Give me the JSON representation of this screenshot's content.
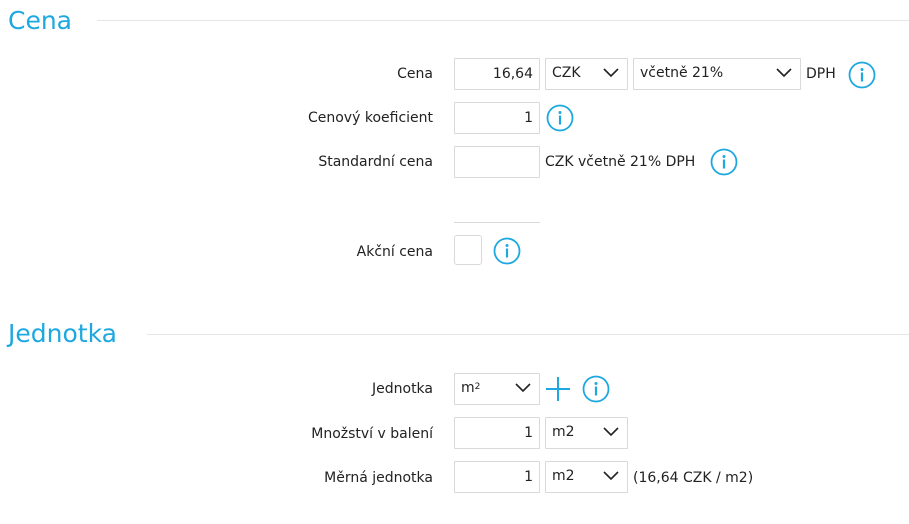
{
  "sections": {
    "cena": {
      "title": "Cena",
      "price": {
        "label": "Cena",
        "value": "16,64",
        "currency": "CZK",
        "vat": "včetně 21%",
        "suffix": "DPH"
      },
      "coefficient": {
        "label": "Cenový koeficient",
        "value": "1"
      },
      "standard": {
        "label": "Standardní cena",
        "value": "",
        "suffix": "CZK včetně 21% DPH"
      },
      "sale": {
        "label": "Akční cena",
        "checked": false
      }
    },
    "jednotka": {
      "title": "Jednotka",
      "unit": {
        "label": "Jednotka",
        "value_base": "m",
        "value_sup": "2"
      },
      "package": {
        "label": "Množství v balení",
        "value": "1",
        "unit": "m2"
      },
      "measure": {
        "label": "Měrná jednotka",
        "value": "1",
        "unit": "m2",
        "note": "(16,64 CZK / m2)"
      }
    }
  },
  "icons": {
    "info": "info-icon",
    "dropdown": "chevron-down-icon",
    "add": "plus-icon"
  },
  "colors": {
    "accent": "#1ea8e0",
    "border": "#d9d9d9",
    "rule": "#e6e6e6",
    "text": "#222222"
  }
}
